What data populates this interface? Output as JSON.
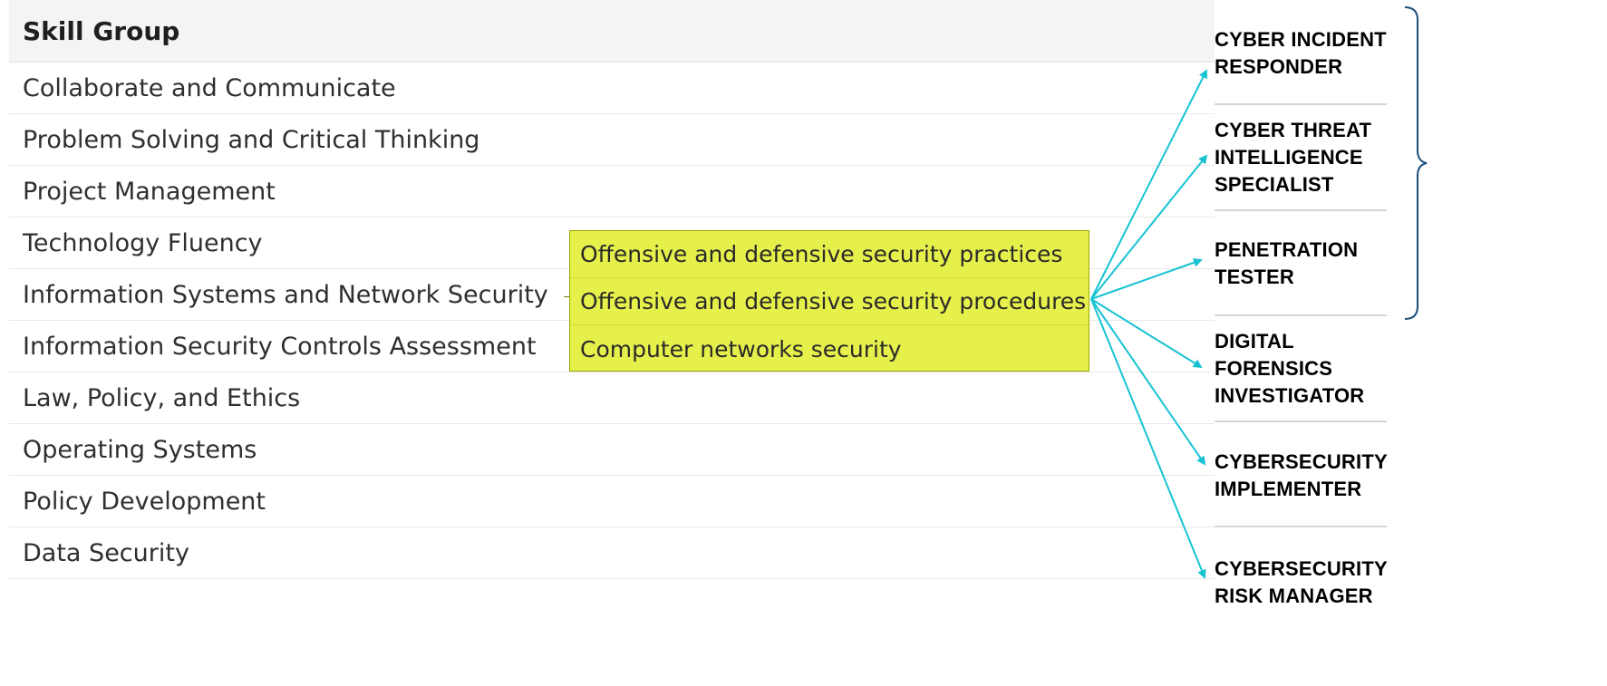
{
  "table": {
    "header": "Skill Group",
    "rows": [
      "Collaborate and Communicate",
      "Problem Solving and Critical Thinking",
      "Project Management",
      "Technology Fluency",
      "Information Systems and Network Security",
      "Information Security Controls Assessment",
      "Law, Policy, and Ethics",
      "Operating Systems",
      "Policy Development",
      "Data Security"
    ]
  },
  "skills": [
    "Offensive and defensive security practices",
    "Offensive and defensive security procedures",
    "Computer networks security"
  ],
  "roles": [
    {
      "line1": "CYBER INCIDENT",
      "line2": "RESPONDER"
    },
    {
      "line1": "CYBER THREAT",
      "line2": "INTELLIGENCE",
      "line3": "SPECIALIST"
    },
    {
      "line1": "PENETRATION",
      "line2": "TESTER"
    },
    {
      "line1": "DIGITAL",
      "line2": "FORENSICS",
      "line3": "INVESTIGATOR"
    },
    {
      "line1": "CYBERSECURITY",
      "line2": "IMPLEMENTER"
    },
    {
      "line1": "CYBERSECURITY",
      "line2": "RISK MANAGER"
    }
  ],
  "colors": {
    "highlight": "#e6f04a",
    "arrow": "#17c3d3",
    "brace": "#1f4e79"
  }
}
